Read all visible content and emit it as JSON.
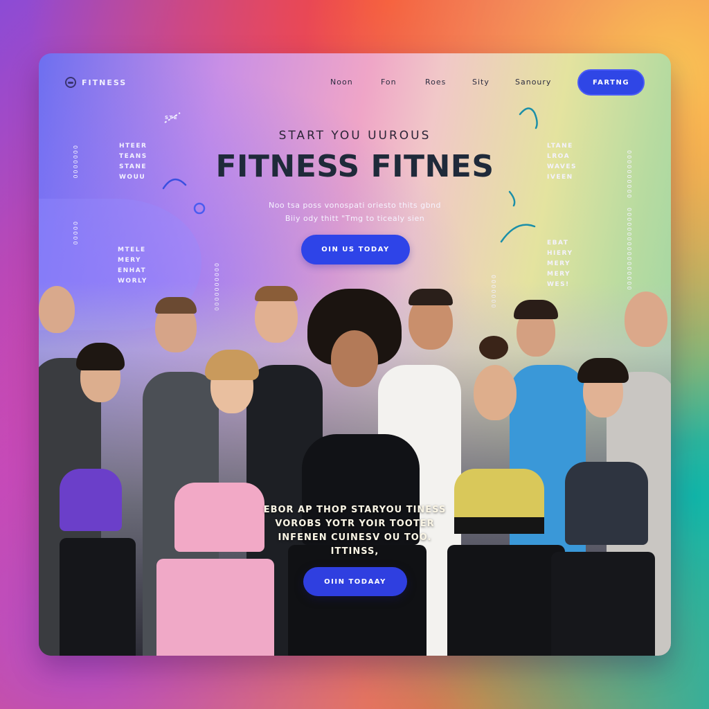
{
  "brand": {
    "name": "FITNESS"
  },
  "nav": {
    "links": [
      "Noon",
      "Fon",
      "Roes",
      "Sity",
      "Sanoury"
    ],
    "cta": "FARTNG"
  },
  "hero": {
    "eyebrow": "START YOU UUROUS",
    "headline": "FITNESS FITNES",
    "subline_1": "Noo tsa poss vonospati oriesto thits gbnd",
    "subline_2": "Biiy ody thitt \"Tmg to ticealy sien",
    "cta": "OIN US TODAY"
  },
  "scatter_text": {
    "left_top": "HTEER\nTEANS\nSTANE\nWOUU",
    "left_mid": "MTELE\nMERY\nENHAT\nWORLY",
    "right_top": "LTANE\nLROA\nWAVES\nIVEEN",
    "right_mid": "EBAT\nHIERY\nMERY\nMERY\nWES!",
    "tiny_left": "STE",
    "vert_left_1": "0000000",
    "vert_left_2": "00000",
    "vert_mid_left": "0000000000",
    "vert_right_1": "0000000000",
    "vert_right_2": "00000000000000000",
    "vert_mid_right": "0000000"
  },
  "body": {
    "line_1": "EBOR AP THOP STARYOU TINESS",
    "line_2": "VOROBS YOTR YOIR TOOTER",
    "line_3": "INFENEN CUINESV OU TOO.",
    "line_4": "ITTINSS,",
    "cta": "OIIN TODAAY"
  },
  "colors": {
    "accent": "#2f46e6",
    "headline": "#1f2a3a"
  }
}
